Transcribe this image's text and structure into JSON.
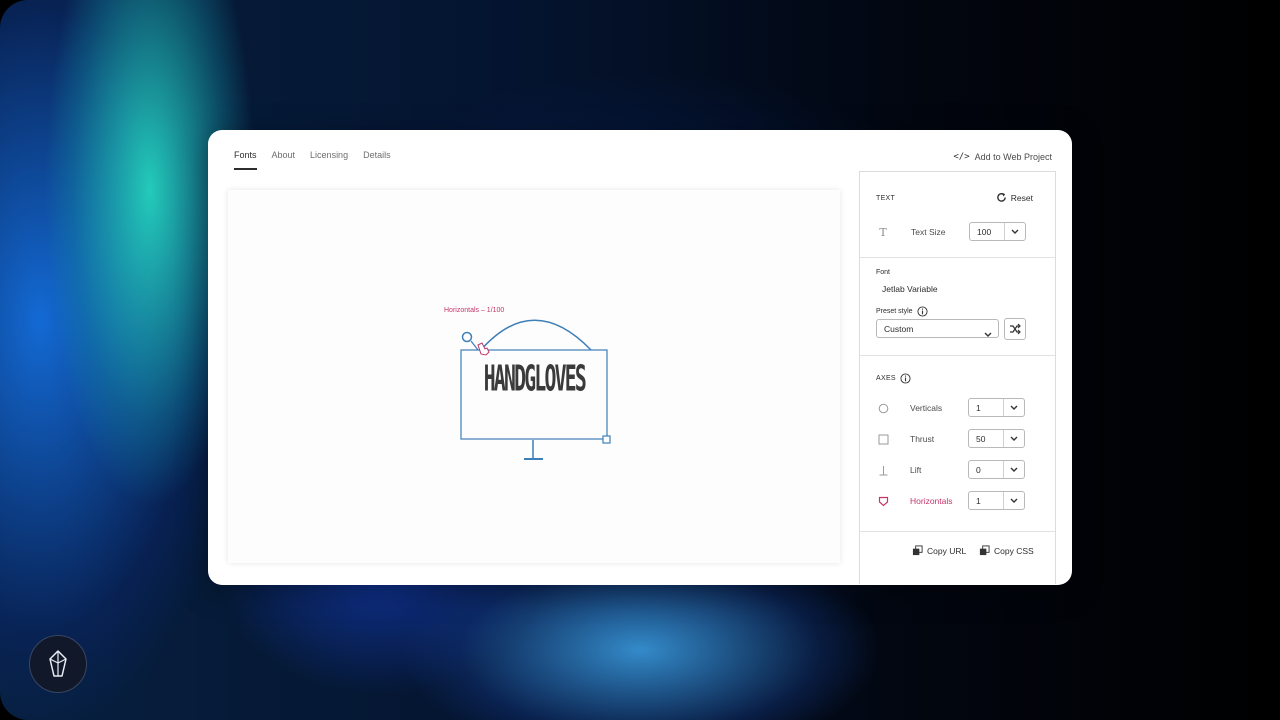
{
  "tabs": [
    "Fonts",
    "About",
    "Licensing",
    "Details"
  ],
  "add_web_project": "Add to Web Project",
  "canvas": {
    "hint": "Horizontals – 1/100",
    "sample_text": "HANDGLOVES"
  },
  "sidebar": {
    "text_section": {
      "title": "TEXT",
      "reset_label": "Reset",
      "text_size_label": "Text Size",
      "text_size_value": "100"
    },
    "font_section": {
      "font_label": "Font",
      "font_name": "Jetlab Variable",
      "preset_label": "Preset style",
      "preset_value": "Custom"
    },
    "axes_section": {
      "title": "AXES",
      "axes": [
        {
          "name": "Verticals",
          "value": "1",
          "icon": "circle-icon"
        },
        {
          "name": "Thrust",
          "value": "50",
          "icon": "square-icon"
        },
        {
          "name": "Lift",
          "value": "0",
          "icon": "lift-icon"
        },
        {
          "name": "Horizontals",
          "value": "1",
          "icon": "shield-icon",
          "active_color": "#c2366a"
        }
      ]
    },
    "copy_url": "Copy URL",
    "copy_css": "Copy CSS"
  },
  "colors": {
    "accent": "#c2366a",
    "handle_blue": "#3d7fb8"
  }
}
